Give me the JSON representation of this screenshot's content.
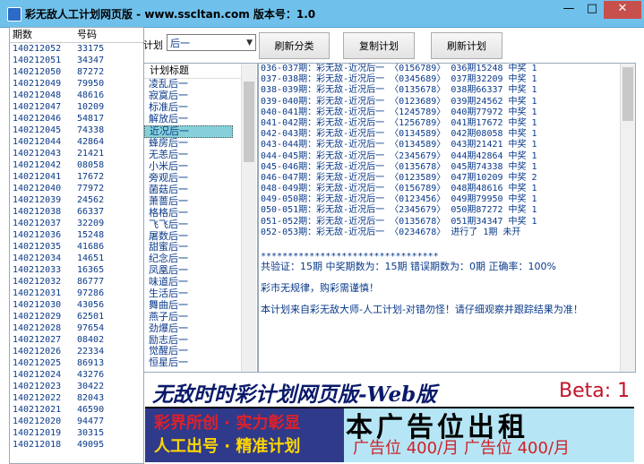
{
  "window": {
    "title": "彩无敌人工计划网页版 - www.sscltan.com 版本号：1.0",
    "minimize_label": "—",
    "maximize_label": "□",
    "close_label": "✕"
  },
  "history": {
    "columns": [
      "期数",
      "号码"
    ],
    "rows": [
      [
        "140212052",
        "33175"
      ],
      [
        "140212051",
        "34347"
      ],
      [
        "140212050",
        "87272"
      ],
      [
        "140212049",
        "79950"
      ],
      [
        "140212048",
        "48616"
      ],
      [
        "140212047",
        "10209"
      ],
      [
        "140212046",
        "54817"
      ],
      [
        "140212045",
        "74338"
      ],
      [
        "140212044",
        "42864"
      ],
      [
        "140212043",
        "21421"
      ],
      [
        "140212042",
        "08058"
      ],
      [
        "140212041",
        "17672"
      ],
      [
        "140212040",
        "77972"
      ],
      [
        "140212039",
        "24562"
      ],
      [
        "140212038",
        "66337"
      ],
      [
        "140212037",
        "32209"
      ],
      [
        "140212036",
        "15248"
      ],
      [
        "140212035",
        "41686"
      ],
      [
        "140212034",
        "14651"
      ],
      [
        "140212033",
        "16365"
      ],
      [
        "140212032",
        "86777"
      ],
      [
        "140212031",
        "97286"
      ],
      [
        "140212030",
        "43056"
      ],
      [
        "140212029",
        "62501"
      ],
      [
        "140212028",
        "97654"
      ],
      [
        "140212027",
        "08402"
      ],
      [
        "140212026",
        "22334"
      ],
      [
        "140212025",
        "86913"
      ],
      [
        "140212024",
        "43276"
      ],
      [
        "140212023",
        "30422"
      ],
      [
        "140212022",
        "82043"
      ],
      [
        "140212021",
        "46590"
      ],
      [
        "140212020",
        "94477"
      ],
      [
        "140212019",
        "30315"
      ],
      [
        "140212018",
        "49095"
      ]
    ]
  },
  "controls": {
    "plan_label": "计划",
    "plan_select_value": "后一",
    "refresh_category_button": "刷新分类",
    "copy_plan_button": "复制计划",
    "refresh_plan_button": "刷新计划"
  },
  "plan_list": {
    "header": "计划标题",
    "items": [
      "凌乱后一",
      "寂寞后一",
      "标准后一",
      "解放后一",
      "近况后一",
      "蜂房后一",
      "无恙后一",
      "小米后一",
      "旁观后一",
      "菌菇后一",
      "萧蔷后一",
      "格格后一",
      "飞飞后一",
      "屠数后一",
      "甜蜜后一",
      "纪念后一",
      "凤凰后一",
      "味道后一",
      "生活后一",
      "舞曲后一",
      "燕子后一",
      "劲爆后一",
      "励志后一",
      "觉醒后一",
      "恒星后一"
    ],
    "selected_index": 4
  },
  "output": {
    "lines": [
      "036-037期：彩无敌-近况后一 〈0156789〉 036期15248 中奖 1",
      "037-038期：彩无敌-近况后一 〈0345689〉 037期32209 中奖 1",
      "038-039期：彩无敌-近况后一 〈0135678〉 038期66337 中奖 1",
      "039-040期：彩无敌-近况后一 〈0123689〉 039期24562 中奖 1",
      "040-041期：彩无敌-近况后一 〈1245789〉 040期77972 中奖 1",
      "041-042期：彩无敌-近况后一 〈1256789〉 041期17672 中奖 1",
      "042-043期：彩无敌-近况后一 〈0134589〉 042期08058 中奖 1",
      "043-044期：彩无敌-近况后一 〈0134589〉 043期21421 中奖 1",
      "044-045期：彩无敌-近况后一 〈2345679〉 044期42864 中奖 1",
      "045-046期：彩无敌-近况后一 〈0135678〉 045期74338 中奖 1",
      "046-047期：彩无敌-近况后一 〈0123589〉 047期10209 中奖 2",
      "048-049期：彩无敌-近况后一 〈0156789〉 048期48616 中奖 1",
      "049-050期：彩无敌-近况后一 〈0123456〉 049期79950 中奖 1",
      "050-051期：彩无敌-近况后一 〈2345679〉 050期87272 中奖 1",
      "051-052期：彩无敌-近况后一 〈0135678〉 051期34347 中奖 1",
      "052-053期：彩无敌-近况后一 〈0234678〉 进行了 1期 未开"
    ],
    "stars": "*********************************",
    "summary": "共验证：15期  中奖期数为：15期 错误期数为：0期 正确率：100%",
    "warning": "彩市无规律，购彩需谨慎！",
    "credit": "本计划来自彩无敌大师-人工计划-对错勿怪！请仔细观察并跟踪结果为准！"
  },
  "ad": {
    "title": "无敌时时彩计划网页版-Web版",
    "beta": "Beta: 1",
    "left_line1": "彩界所创 · 实力彰显",
    "left_line2": "人工出号 · 精准计划",
    "right_line1": "本广告位出租",
    "right_line2": "广告位 400/月  广告位 400/月"
  }
}
